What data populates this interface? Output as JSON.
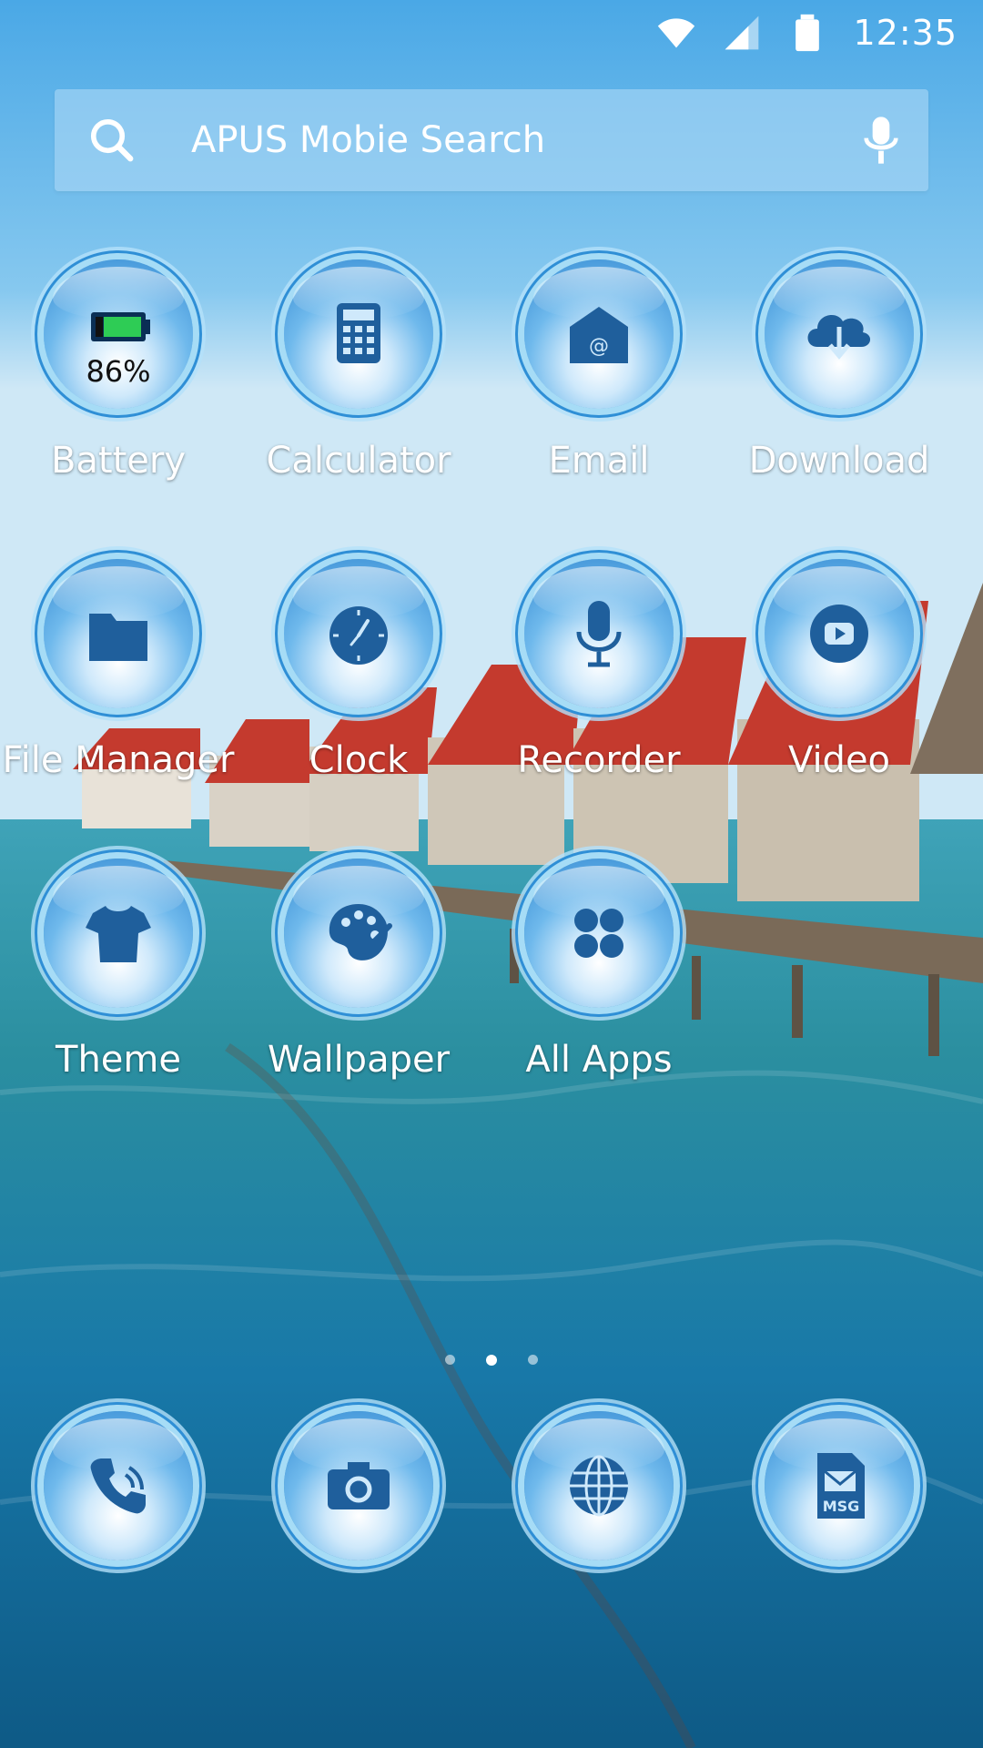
{
  "status_bar": {
    "time": "12:35",
    "icons": [
      "wifi-icon",
      "signal-icon",
      "battery-icon"
    ]
  },
  "search": {
    "placeholder": "APUS Mobie Search",
    "icon": "search-icon",
    "voice_icon": "mic-icon"
  },
  "apps": [
    {
      "label": "Battery",
      "icon": "battery-icon",
      "battery_percent": "86%"
    },
    {
      "label": "Calculator",
      "icon": "calculator-icon"
    },
    {
      "label": "Email",
      "icon": "email-icon"
    },
    {
      "label": "Download",
      "icon": "cloud-download-icon"
    },
    {
      "label": "File Manager",
      "icon": "folder-icon"
    },
    {
      "label": "Clock",
      "icon": "clock-icon"
    },
    {
      "label": "Recorder",
      "icon": "microphone-icon"
    },
    {
      "label": "Video",
      "icon": "play-icon"
    },
    {
      "label": "Theme",
      "icon": "tshirt-icon"
    },
    {
      "label": "Wallpaper",
      "icon": "palette-icon"
    },
    {
      "label": "All Apps",
      "icon": "grid-icon"
    }
  ],
  "dock": [
    {
      "icon": "phone-icon"
    },
    {
      "icon": "camera-icon"
    },
    {
      "icon": "globe-icon"
    },
    {
      "icon": "message-icon",
      "badge_text": "MSG"
    }
  ],
  "page_indicator": {
    "pages": 3,
    "active": 2
  },
  "colors": {
    "icon_glyph": "#1f5f9c",
    "bubble_ring": "#2f8fd6",
    "label_text": "#ffffff"
  }
}
